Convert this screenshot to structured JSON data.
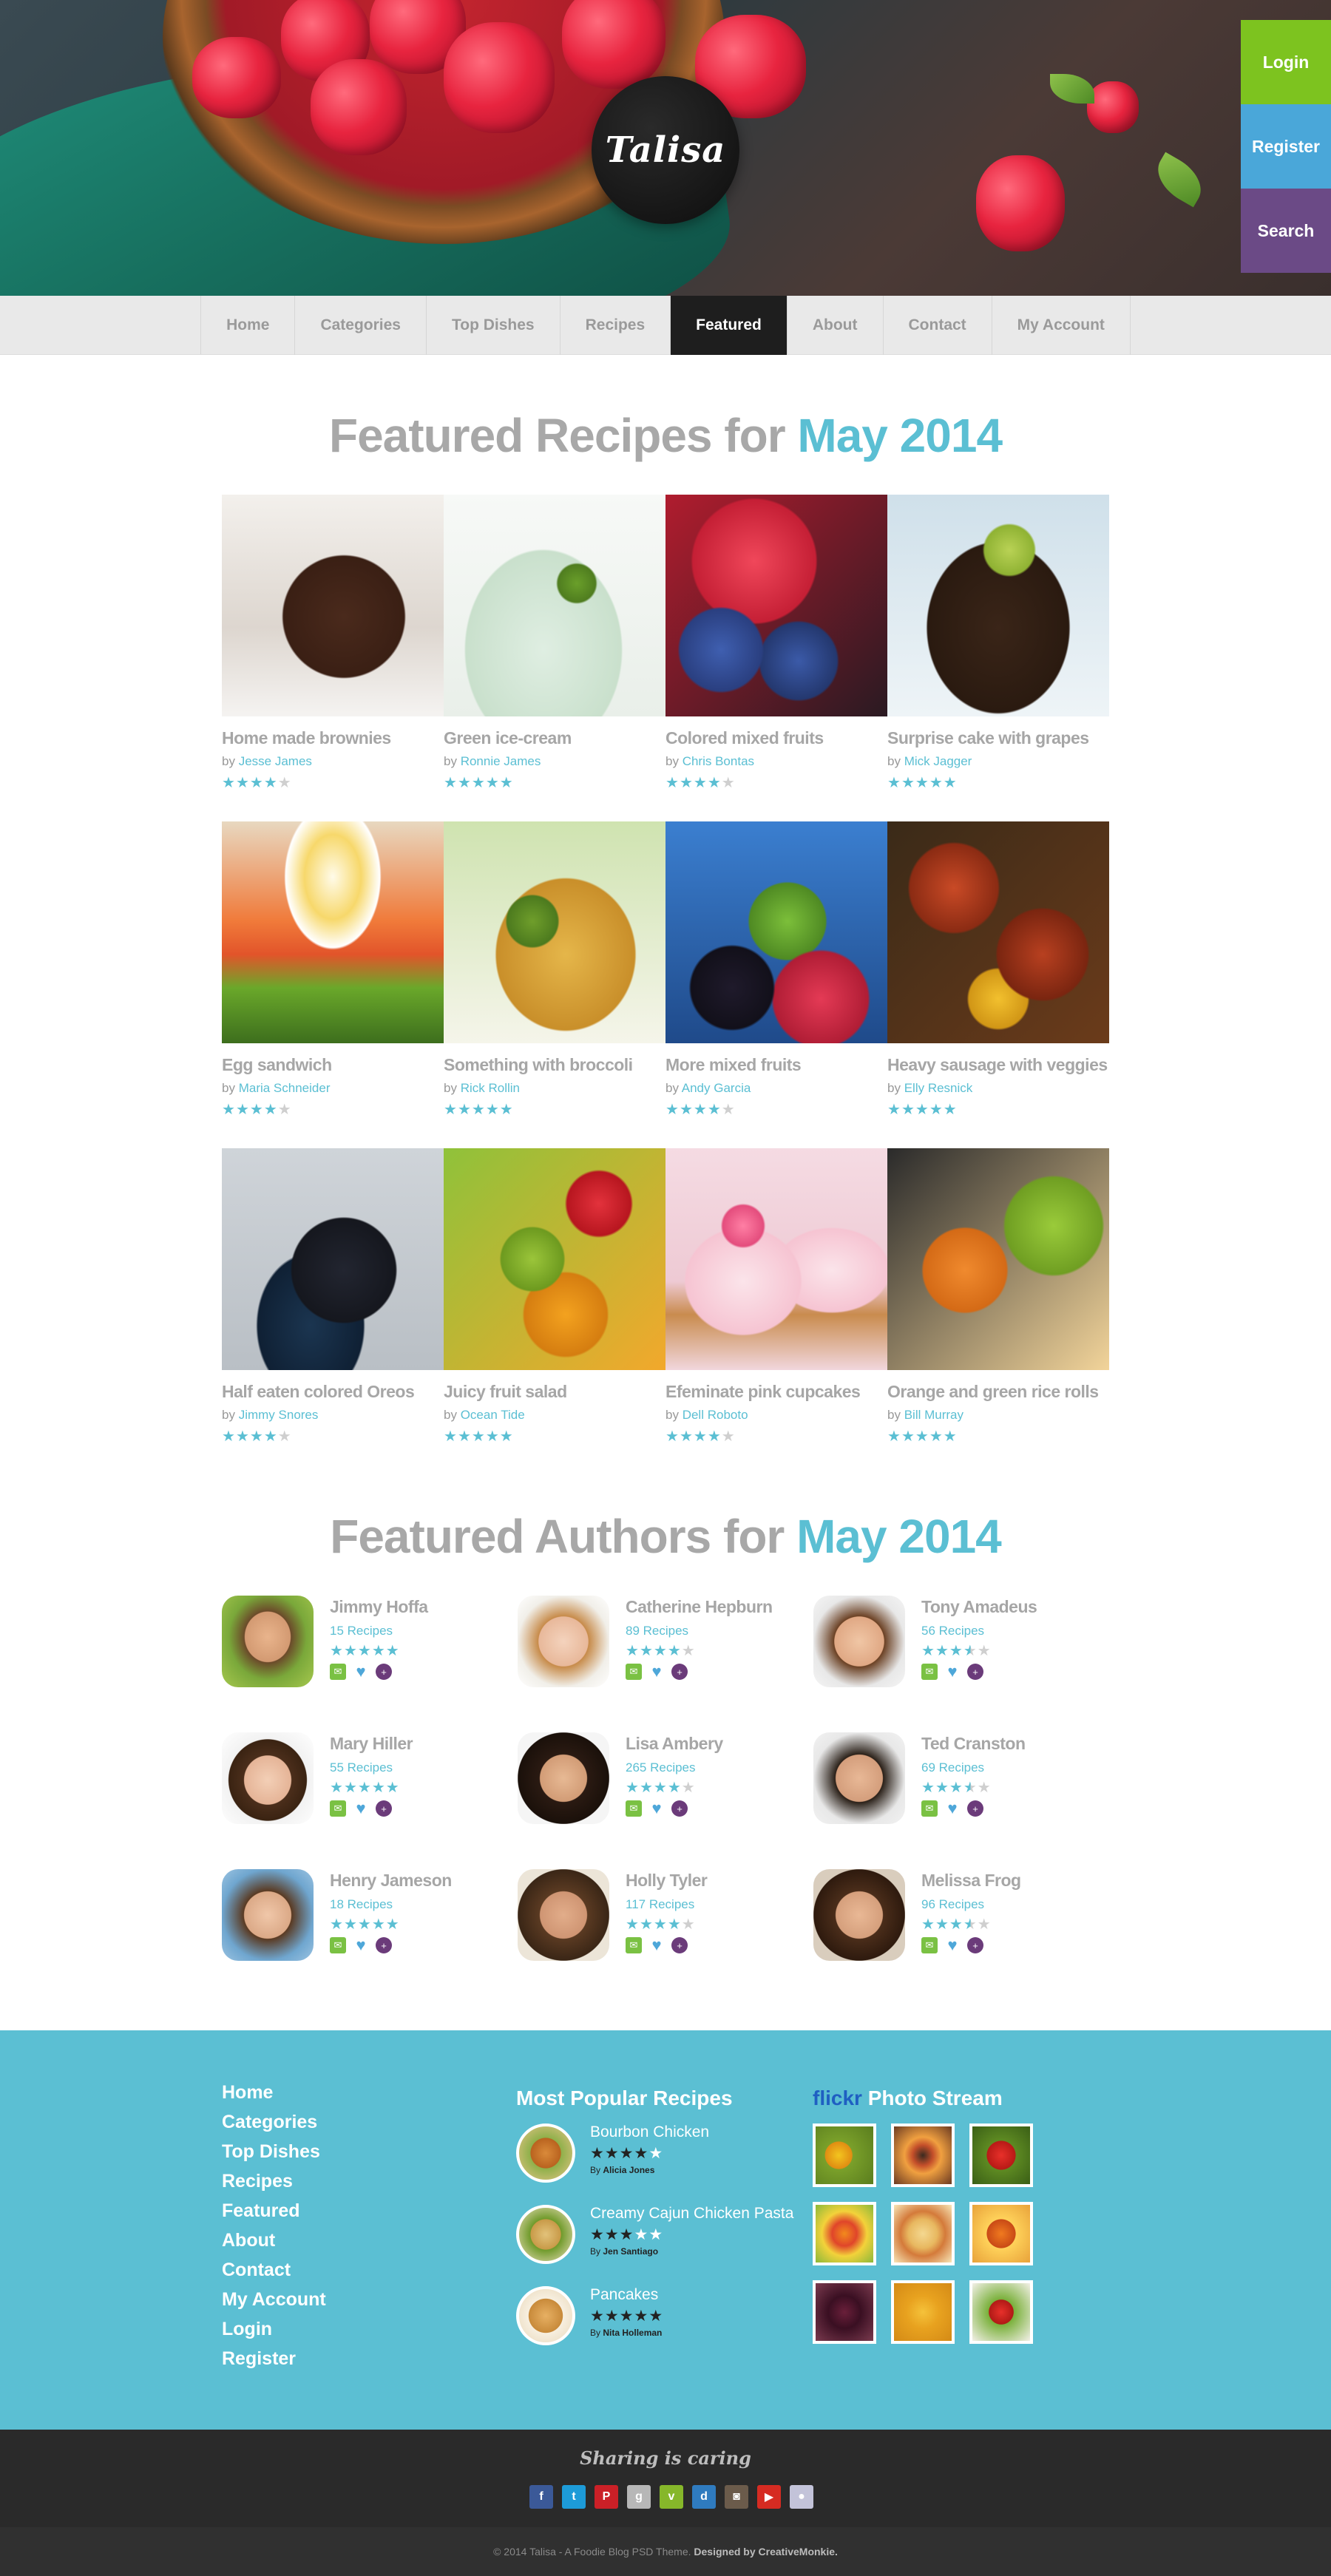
{
  "brand": {
    "logo": "Talisa"
  },
  "side_tabs": [
    {
      "label": "Login",
      "color": "#7dc31f"
    },
    {
      "label": "Register",
      "color": "#4aa7d9"
    },
    {
      "label": "Search",
      "color": "#6b4a86"
    }
  ],
  "nav": [
    {
      "label": "Home"
    },
    {
      "label": "Categories"
    },
    {
      "label": "Top Dishes"
    },
    {
      "label": "Recipes"
    },
    {
      "label": "Featured",
      "active": true
    },
    {
      "label": "About"
    },
    {
      "label": "Contact"
    },
    {
      "label": "My Account"
    }
  ],
  "featured_recipes": {
    "title_prefix": "Featured Recipes for",
    "title_accent": "May 2014",
    "items": [
      {
        "name": "Home made brownies",
        "by": "by",
        "author": "Jesse James",
        "rating": 4
      },
      {
        "name": "Green ice-cream",
        "by": "by",
        "author": "Ronnie James",
        "rating": 5
      },
      {
        "name": "Colored mixed fruits",
        "by": "by",
        "author": "Chris Bontas",
        "rating": 4
      },
      {
        "name": "Surprise cake with grapes",
        "by": "by",
        "author": "Mick Jagger",
        "rating": 5
      },
      {
        "name": "Egg sandwich",
        "by": "by",
        "author": "Maria Schneider",
        "rating": 4
      },
      {
        "name": "Something with broccoli",
        "by": "by",
        "author": "Rick Rollin",
        "rating": 5
      },
      {
        "name": "More mixed fruits",
        "by": "by",
        "author": "Andy Garcia",
        "rating": 4
      },
      {
        "name": "Heavy sausage with veggies",
        "by": "by",
        "author": "Elly Resnick",
        "rating": 5
      },
      {
        "name": "Half eaten colored Oreos",
        "by": "by",
        "author": "Jimmy Snores",
        "rating": 4
      },
      {
        "name": "Juicy fruit salad",
        "by": "by",
        "author": "Ocean Tide",
        "rating": 5
      },
      {
        "name": "Efeminate pink cupcakes",
        "by": "by",
        "author": "Dell Roboto",
        "rating": 4
      },
      {
        "name": "Orange and green rice rolls",
        "by": "by",
        "author": "Bill Murray",
        "rating": 5
      }
    ]
  },
  "featured_authors": {
    "title_prefix": "Featured Authors for",
    "title_accent": "May 2014",
    "items": [
      {
        "name": "Jimmy Hoffa",
        "count": "15 Recipes",
        "rating": 5
      },
      {
        "name": "Catherine Hepburn",
        "count": "89 Recipes",
        "rating": 4
      },
      {
        "name": "Tony Amadeus",
        "count": "56 Recipes",
        "rating": 3.5
      },
      {
        "name": "Mary Hiller",
        "count": "55 Recipes",
        "rating": 5
      },
      {
        "name": "Lisa Ambery",
        "count": "265 Recipes",
        "rating": 4
      },
      {
        "name": "Ted Cranston",
        "count": "69 Recipes",
        "rating": 3.5
      },
      {
        "name": "Henry Jameson",
        "count": "18 Recipes",
        "rating": 5
      },
      {
        "name": "Holly Tyler",
        "count": "117 Recipes",
        "rating": 4
      },
      {
        "name": "Melissa Frog",
        "count": "96 Recipes",
        "rating": 3.5
      }
    ]
  },
  "footer": {
    "links": [
      "Home",
      "Categories",
      "Top Dishes",
      "Recipes",
      "Featured",
      "About",
      "Contact",
      "My Account",
      "Login",
      "Register"
    ],
    "popular_title": "Most Popular Recipes",
    "popular": [
      {
        "title": "Bourbon Chicken",
        "rating": 4,
        "by": "By",
        "author": "Alicia Jones"
      },
      {
        "title": "Creamy Cajun Chicken Pasta",
        "rating": 3,
        "by": "By",
        "author": "Jen Santiago"
      },
      {
        "title": "Pancakes",
        "rating": 5,
        "by": "By",
        "author": "Nita Holleman"
      }
    ],
    "flickr_word": "flickr",
    "flickr_title": "Photo Stream",
    "share_title": "Sharing is caring",
    "share_icons": [
      {
        "glyph": "f",
        "color": "#3b5998",
        "name": "facebook"
      },
      {
        "glyph": "t",
        "color": "#1d9bd8",
        "name": "twitter"
      },
      {
        "glyph": "P",
        "color": "#cb2027",
        "name": "pinterest"
      },
      {
        "glyph": "g",
        "color": "#b7b7b7",
        "name": "google-plus"
      },
      {
        "glyph": "v",
        "color": "#86b72a",
        "name": "vimeo"
      },
      {
        "glyph": "d",
        "color": "#2f7bbf",
        "name": "delicious"
      },
      {
        "glyph": "◙",
        "color": "#6b5b4b",
        "name": "instagram"
      },
      {
        "glyph": "▶",
        "color": "#d62b22",
        "name": "youtube"
      },
      {
        "glyph": "●",
        "color": "#c3c3d9",
        "name": "flickr"
      }
    ],
    "copyright": "© 2014 Talisa - A Foodie Blog PSD Theme.",
    "designed_by": "Designed by CreativeMonkie."
  }
}
